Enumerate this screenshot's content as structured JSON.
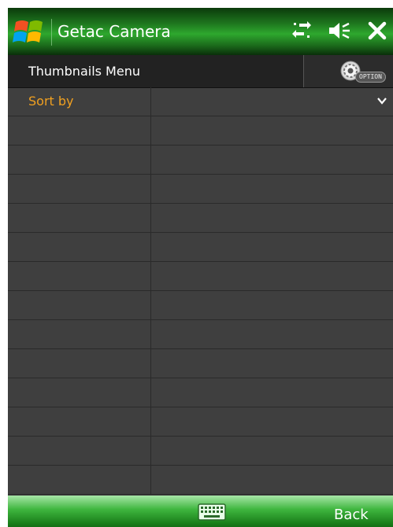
{
  "titlebar": {
    "app_title": "Getac Camera"
  },
  "menu": {
    "title": "Thumbnails Menu",
    "option_label": "OPTION"
  },
  "list": {
    "sort_label": "Sort by",
    "sort_value": ""
  },
  "bottombar": {
    "back_label": "Back"
  },
  "colors": {
    "accent_orange": "#f0a020",
    "titlebar_green": "#2ea82e"
  }
}
